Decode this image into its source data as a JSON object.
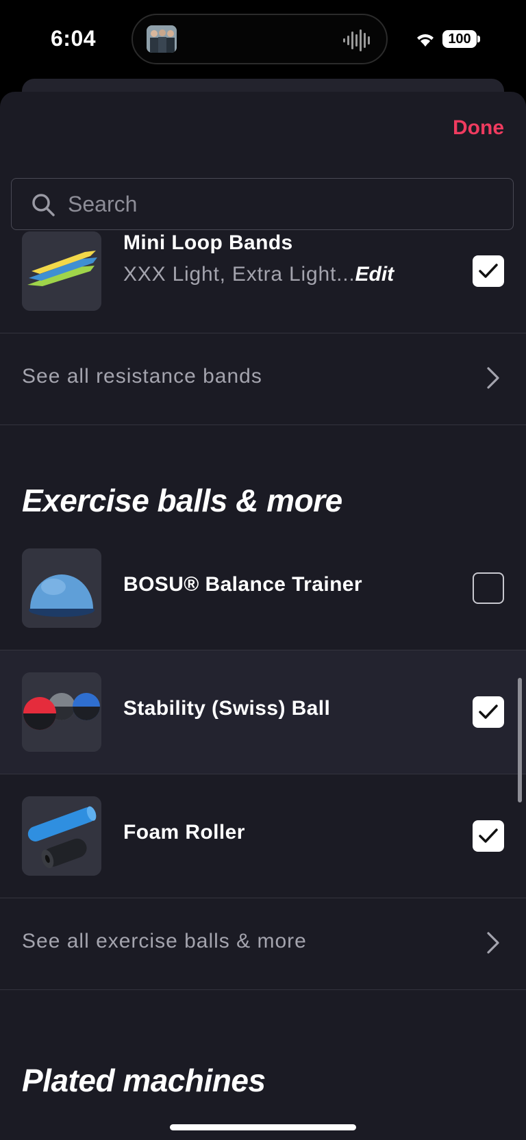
{
  "status_bar": {
    "time": "6:04",
    "battery": "100"
  },
  "header": {
    "done_label": "Done"
  },
  "search": {
    "placeholder": "Search",
    "value": ""
  },
  "items": [
    {
      "title": "Mini Loop Bands",
      "subtitle": "XXX Light, Extra Light...",
      "edit_label": "Edit",
      "checked": true,
      "image": "mini-loop-bands"
    },
    {
      "title": "BOSU® Balance Trainer",
      "checked": false,
      "image": "bosu-balance-trainer"
    },
    {
      "title": "Stability (Swiss) Ball",
      "checked": true,
      "image": "stability-balls"
    },
    {
      "title": "Foam Roller",
      "checked": true,
      "image": "foam-roller"
    }
  ],
  "links": {
    "resistance_bands": "See all resistance bands",
    "exercise_balls": "See all exercise balls & more"
  },
  "sections": {
    "exercise_balls": "Exercise balls & more",
    "plated_machines": "Plated machines"
  },
  "colors": {
    "accent": "#ef3b5f",
    "sheet_bg": "#1b1b24",
    "row_highlight": "#23232f"
  }
}
